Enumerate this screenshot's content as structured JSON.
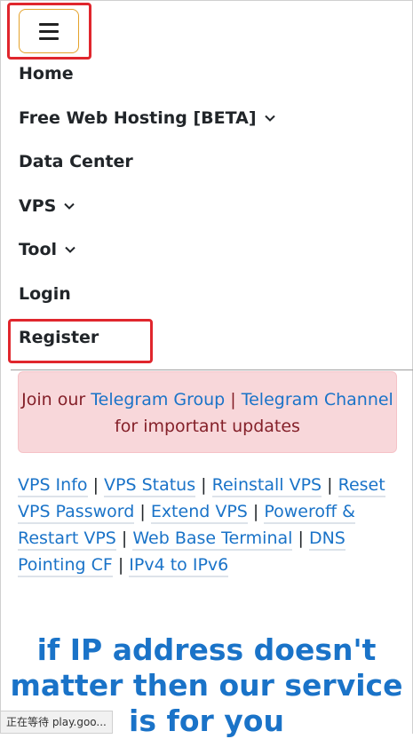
{
  "nav": {
    "toggler_icon": "hamburger-icon",
    "items": [
      {
        "label": "Home",
        "dropdown": false
      },
      {
        "label": "Free Web Hosting [BETA]",
        "dropdown": true
      },
      {
        "label": "Data Center",
        "dropdown": false
      },
      {
        "label": "VPS",
        "dropdown": true
      },
      {
        "label": "Tool",
        "dropdown": true
      },
      {
        "label": "Login",
        "dropdown": false
      },
      {
        "label": "Register",
        "dropdown": false
      }
    ]
  },
  "alert": {
    "prefix": "Join our",
    "link1": "Telegram Group",
    "sep": "|",
    "link2": "Telegram Channel",
    "suffix": "for important updates"
  },
  "links": {
    "items": [
      "VPS Info",
      "VPS Status",
      "Reinstall VPS",
      "Reset VPS Password",
      "Extend VPS",
      "Poweroff & Restart VPS",
      "Web Base Terminal",
      "DNS Pointing CF",
      "IPv4 to IPv6"
    ],
    "separator": "|"
  },
  "headline": "if IP address doesn't matter then our service is for you",
  "status_bar": "正在等待 play.goo...",
  "colors": {
    "highlight": "#e0262d",
    "link": "#1a73c8",
    "alert_bg": "#f8d7da",
    "alert_text": "#842029"
  }
}
